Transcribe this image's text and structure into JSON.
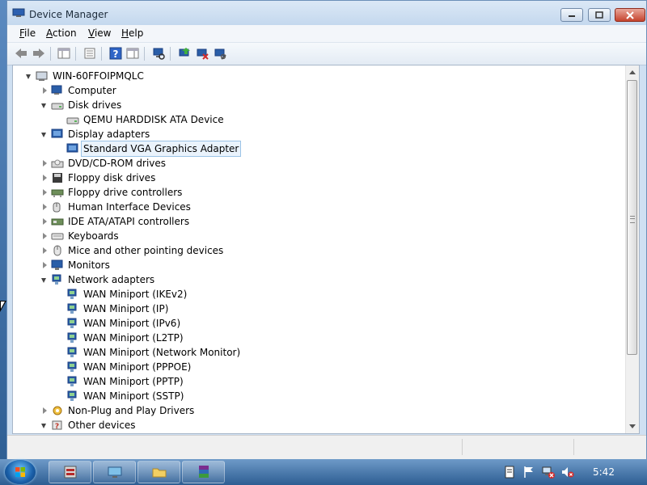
{
  "window": {
    "title": "Device Manager"
  },
  "menu": {
    "file": {
      "underline": "F",
      "rest": "ile"
    },
    "action": {
      "underline": "A",
      "rest": "ction"
    },
    "view": {
      "underline": "V",
      "rest": "iew"
    },
    "help": {
      "underline": "H",
      "rest": "elp"
    }
  },
  "toolbar": {
    "buttons": [
      "back-arrow-icon",
      "forward-arrow-icon",
      "show-hide-console-tree-icon",
      "properties-icon",
      "help-icon",
      "show-action-pane-icon",
      "scan-hardware-icon",
      "update-driver-icon",
      "uninstall-icon",
      "disable-icon"
    ]
  },
  "tree": {
    "root": "WIN-60FFOIPMQLC",
    "items": [
      {
        "label": "Computer",
        "level": 1,
        "state": "closed",
        "icon": "computer-icon"
      },
      {
        "label": "Disk drives",
        "level": 1,
        "state": "open",
        "icon": "disk-drive-icon"
      },
      {
        "label": "QEMU HARDDISK ATA Device",
        "level": 2,
        "state": "none",
        "icon": "disk-drive-icon"
      },
      {
        "label": "Display adapters",
        "level": 1,
        "state": "open",
        "icon": "display-adapter-icon"
      },
      {
        "label": "Standard VGA Graphics Adapter",
        "level": 2,
        "state": "none",
        "icon": "display-adapter-icon",
        "selected": true
      },
      {
        "label": "DVD/CD-ROM drives",
        "level": 1,
        "state": "closed",
        "icon": "dvd-drive-icon"
      },
      {
        "label": "Floppy disk drives",
        "level": 1,
        "state": "closed",
        "icon": "floppy-disk-icon"
      },
      {
        "label": "Floppy drive controllers",
        "level": 1,
        "state": "closed",
        "icon": "floppy-controller-icon"
      },
      {
        "label": "Human Interface Devices",
        "level": 1,
        "state": "closed",
        "icon": "hid-icon"
      },
      {
        "label": "IDE ATA/ATAPI controllers",
        "level": 1,
        "state": "closed",
        "icon": "ide-controller-icon"
      },
      {
        "label": "Keyboards",
        "level": 1,
        "state": "closed",
        "icon": "keyboard-icon"
      },
      {
        "label": "Mice and other pointing devices",
        "level": 1,
        "state": "closed",
        "icon": "mouse-icon"
      },
      {
        "label": "Monitors",
        "level": 1,
        "state": "closed",
        "icon": "monitor-icon"
      },
      {
        "label": "Network adapters",
        "level": 1,
        "state": "open",
        "icon": "network-adapter-icon"
      },
      {
        "label": "WAN Miniport (IKEv2)",
        "level": 2,
        "state": "none",
        "icon": "network-adapter-icon"
      },
      {
        "label": "WAN Miniport (IP)",
        "level": 2,
        "state": "none",
        "icon": "network-adapter-icon"
      },
      {
        "label": "WAN Miniport (IPv6)",
        "level": 2,
        "state": "none",
        "icon": "network-adapter-icon"
      },
      {
        "label": "WAN Miniport (L2TP)",
        "level": 2,
        "state": "none",
        "icon": "network-adapter-icon"
      },
      {
        "label": "WAN Miniport (Network Monitor)",
        "level": 2,
        "state": "none",
        "icon": "network-adapter-icon"
      },
      {
        "label": "WAN Miniport (PPPOE)",
        "level": 2,
        "state": "none",
        "icon": "network-adapter-icon"
      },
      {
        "label": "WAN Miniport (PPTP)",
        "level": 2,
        "state": "none",
        "icon": "network-adapter-icon"
      },
      {
        "label": "WAN Miniport (SSTP)",
        "level": 2,
        "state": "none",
        "icon": "network-adapter-icon"
      },
      {
        "label": "Non-Plug and Play Drivers",
        "level": 1,
        "state": "closed",
        "icon": "driver-icon"
      },
      {
        "label": "Other devices",
        "level": 1,
        "state": "open",
        "icon": "unknown-device-icon"
      }
    ]
  },
  "taskbar": {
    "buttons": [
      "server-manager-icon",
      "remote-desktop-icon",
      "explorer-folder-icon",
      "winrar-icon"
    ],
    "tray": [
      "action-center-icon",
      "flag-icon",
      "network-error-icon",
      "volume-muted-icon"
    ],
    "clock": "5:42"
  },
  "colors": {
    "titlebar": "#cfe0f2",
    "taskbar": "#3d6ea6",
    "selection": "#9bc3e6"
  }
}
